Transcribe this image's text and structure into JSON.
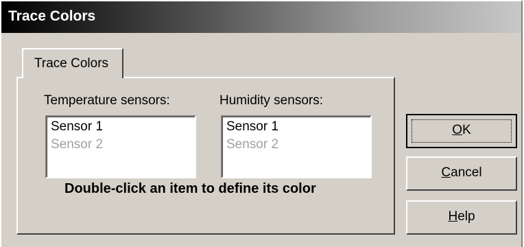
{
  "window": {
    "title": "Trace Colors"
  },
  "tab": {
    "label": "Trace Colors"
  },
  "temperature": {
    "label": "Temperature sensors:",
    "items": [
      {
        "label": "Sensor 1",
        "enabled": true
      },
      {
        "label": "Sensor 2",
        "enabled": false
      }
    ]
  },
  "humidity": {
    "label": "Humidity sensors:",
    "items": [
      {
        "label": "Sensor 1",
        "enabled": true
      },
      {
        "label": "Sensor 2",
        "enabled": false
      }
    ]
  },
  "hint": "Double-click an item to define its color",
  "buttons": {
    "ok": {
      "mnemonic": "O",
      "rest": "K"
    },
    "cancel": {
      "mnemonic": "C",
      "rest": "ancel"
    },
    "help": {
      "mnemonic": "H",
      "rest": "elp"
    }
  },
  "colors": {
    "face": "#d4d0c8",
    "disabled_text": "#a0a0a0"
  }
}
